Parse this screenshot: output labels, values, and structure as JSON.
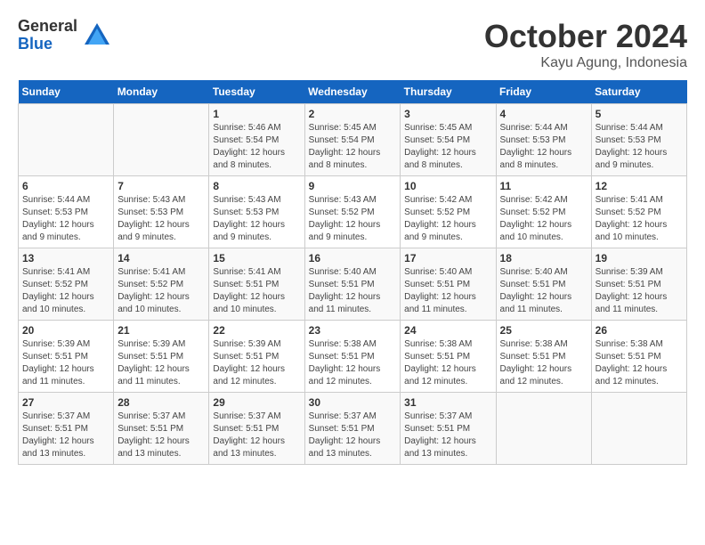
{
  "logo": {
    "general": "General",
    "blue": "Blue"
  },
  "title": "October 2024",
  "subtitle": "Kayu Agung, Indonesia",
  "days_header": [
    "Sunday",
    "Monday",
    "Tuesday",
    "Wednesday",
    "Thursday",
    "Friday",
    "Saturday"
  ],
  "weeks": [
    [
      {
        "day": "",
        "empty": true
      },
      {
        "day": "",
        "empty": true
      },
      {
        "day": "1",
        "sunrise": "5:46 AM",
        "sunset": "5:54 PM",
        "daylight": "12 hours and 8 minutes."
      },
      {
        "day": "2",
        "sunrise": "5:45 AM",
        "sunset": "5:54 PM",
        "daylight": "12 hours and 8 minutes."
      },
      {
        "day": "3",
        "sunrise": "5:45 AM",
        "sunset": "5:54 PM",
        "daylight": "12 hours and 8 minutes."
      },
      {
        "day": "4",
        "sunrise": "5:44 AM",
        "sunset": "5:53 PM",
        "daylight": "12 hours and 8 minutes."
      },
      {
        "day": "5",
        "sunrise": "5:44 AM",
        "sunset": "5:53 PM",
        "daylight": "12 hours and 9 minutes."
      }
    ],
    [
      {
        "day": "6",
        "sunrise": "5:44 AM",
        "sunset": "5:53 PM",
        "daylight": "12 hours and 9 minutes."
      },
      {
        "day": "7",
        "sunrise": "5:43 AM",
        "sunset": "5:53 PM",
        "daylight": "12 hours and 9 minutes."
      },
      {
        "day": "8",
        "sunrise": "5:43 AM",
        "sunset": "5:53 PM",
        "daylight": "12 hours and 9 minutes."
      },
      {
        "day": "9",
        "sunrise": "5:43 AM",
        "sunset": "5:52 PM",
        "daylight": "12 hours and 9 minutes."
      },
      {
        "day": "10",
        "sunrise": "5:42 AM",
        "sunset": "5:52 PM",
        "daylight": "12 hours and 9 minutes."
      },
      {
        "day": "11",
        "sunrise": "5:42 AM",
        "sunset": "5:52 PM",
        "daylight": "12 hours and 10 minutes."
      },
      {
        "day": "12",
        "sunrise": "5:41 AM",
        "sunset": "5:52 PM",
        "daylight": "12 hours and 10 minutes."
      }
    ],
    [
      {
        "day": "13",
        "sunrise": "5:41 AM",
        "sunset": "5:52 PM",
        "daylight": "12 hours and 10 minutes."
      },
      {
        "day": "14",
        "sunrise": "5:41 AM",
        "sunset": "5:52 PM",
        "daylight": "12 hours and 10 minutes."
      },
      {
        "day": "15",
        "sunrise": "5:41 AM",
        "sunset": "5:51 PM",
        "daylight": "12 hours and 10 minutes."
      },
      {
        "day": "16",
        "sunrise": "5:40 AM",
        "sunset": "5:51 PM",
        "daylight": "12 hours and 11 minutes."
      },
      {
        "day": "17",
        "sunrise": "5:40 AM",
        "sunset": "5:51 PM",
        "daylight": "12 hours and 11 minutes."
      },
      {
        "day": "18",
        "sunrise": "5:40 AM",
        "sunset": "5:51 PM",
        "daylight": "12 hours and 11 minutes."
      },
      {
        "day": "19",
        "sunrise": "5:39 AM",
        "sunset": "5:51 PM",
        "daylight": "12 hours and 11 minutes."
      }
    ],
    [
      {
        "day": "20",
        "sunrise": "5:39 AM",
        "sunset": "5:51 PM",
        "daylight": "12 hours and 11 minutes."
      },
      {
        "day": "21",
        "sunrise": "5:39 AM",
        "sunset": "5:51 PM",
        "daylight": "12 hours and 11 minutes."
      },
      {
        "day": "22",
        "sunrise": "5:39 AM",
        "sunset": "5:51 PM",
        "daylight": "12 hours and 12 minutes."
      },
      {
        "day": "23",
        "sunrise": "5:38 AM",
        "sunset": "5:51 PM",
        "daylight": "12 hours and 12 minutes."
      },
      {
        "day": "24",
        "sunrise": "5:38 AM",
        "sunset": "5:51 PM",
        "daylight": "12 hours and 12 minutes."
      },
      {
        "day": "25",
        "sunrise": "5:38 AM",
        "sunset": "5:51 PM",
        "daylight": "12 hours and 12 minutes."
      },
      {
        "day": "26",
        "sunrise": "5:38 AM",
        "sunset": "5:51 PM",
        "daylight": "12 hours and 12 minutes."
      }
    ],
    [
      {
        "day": "27",
        "sunrise": "5:37 AM",
        "sunset": "5:51 PM",
        "daylight": "12 hours and 13 minutes."
      },
      {
        "day": "28",
        "sunrise": "5:37 AM",
        "sunset": "5:51 PM",
        "daylight": "12 hours and 13 minutes."
      },
      {
        "day": "29",
        "sunrise": "5:37 AM",
        "sunset": "5:51 PM",
        "daylight": "12 hours and 13 minutes."
      },
      {
        "day": "30",
        "sunrise": "5:37 AM",
        "sunset": "5:51 PM",
        "daylight": "12 hours and 13 minutes."
      },
      {
        "day": "31",
        "sunrise": "5:37 AM",
        "sunset": "5:51 PM",
        "daylight": "12 hours and 13 minutes."
      },
      {
        "day": "",
        "empty": true
      },
      {
        "day": "",
        "empty": true
      }
    ]
  ],
  "labels": {
    "sunrise": "Sunrise:",
    "sunset": "Sunset:",
    "daylight": "Daylight:"
  }
}
